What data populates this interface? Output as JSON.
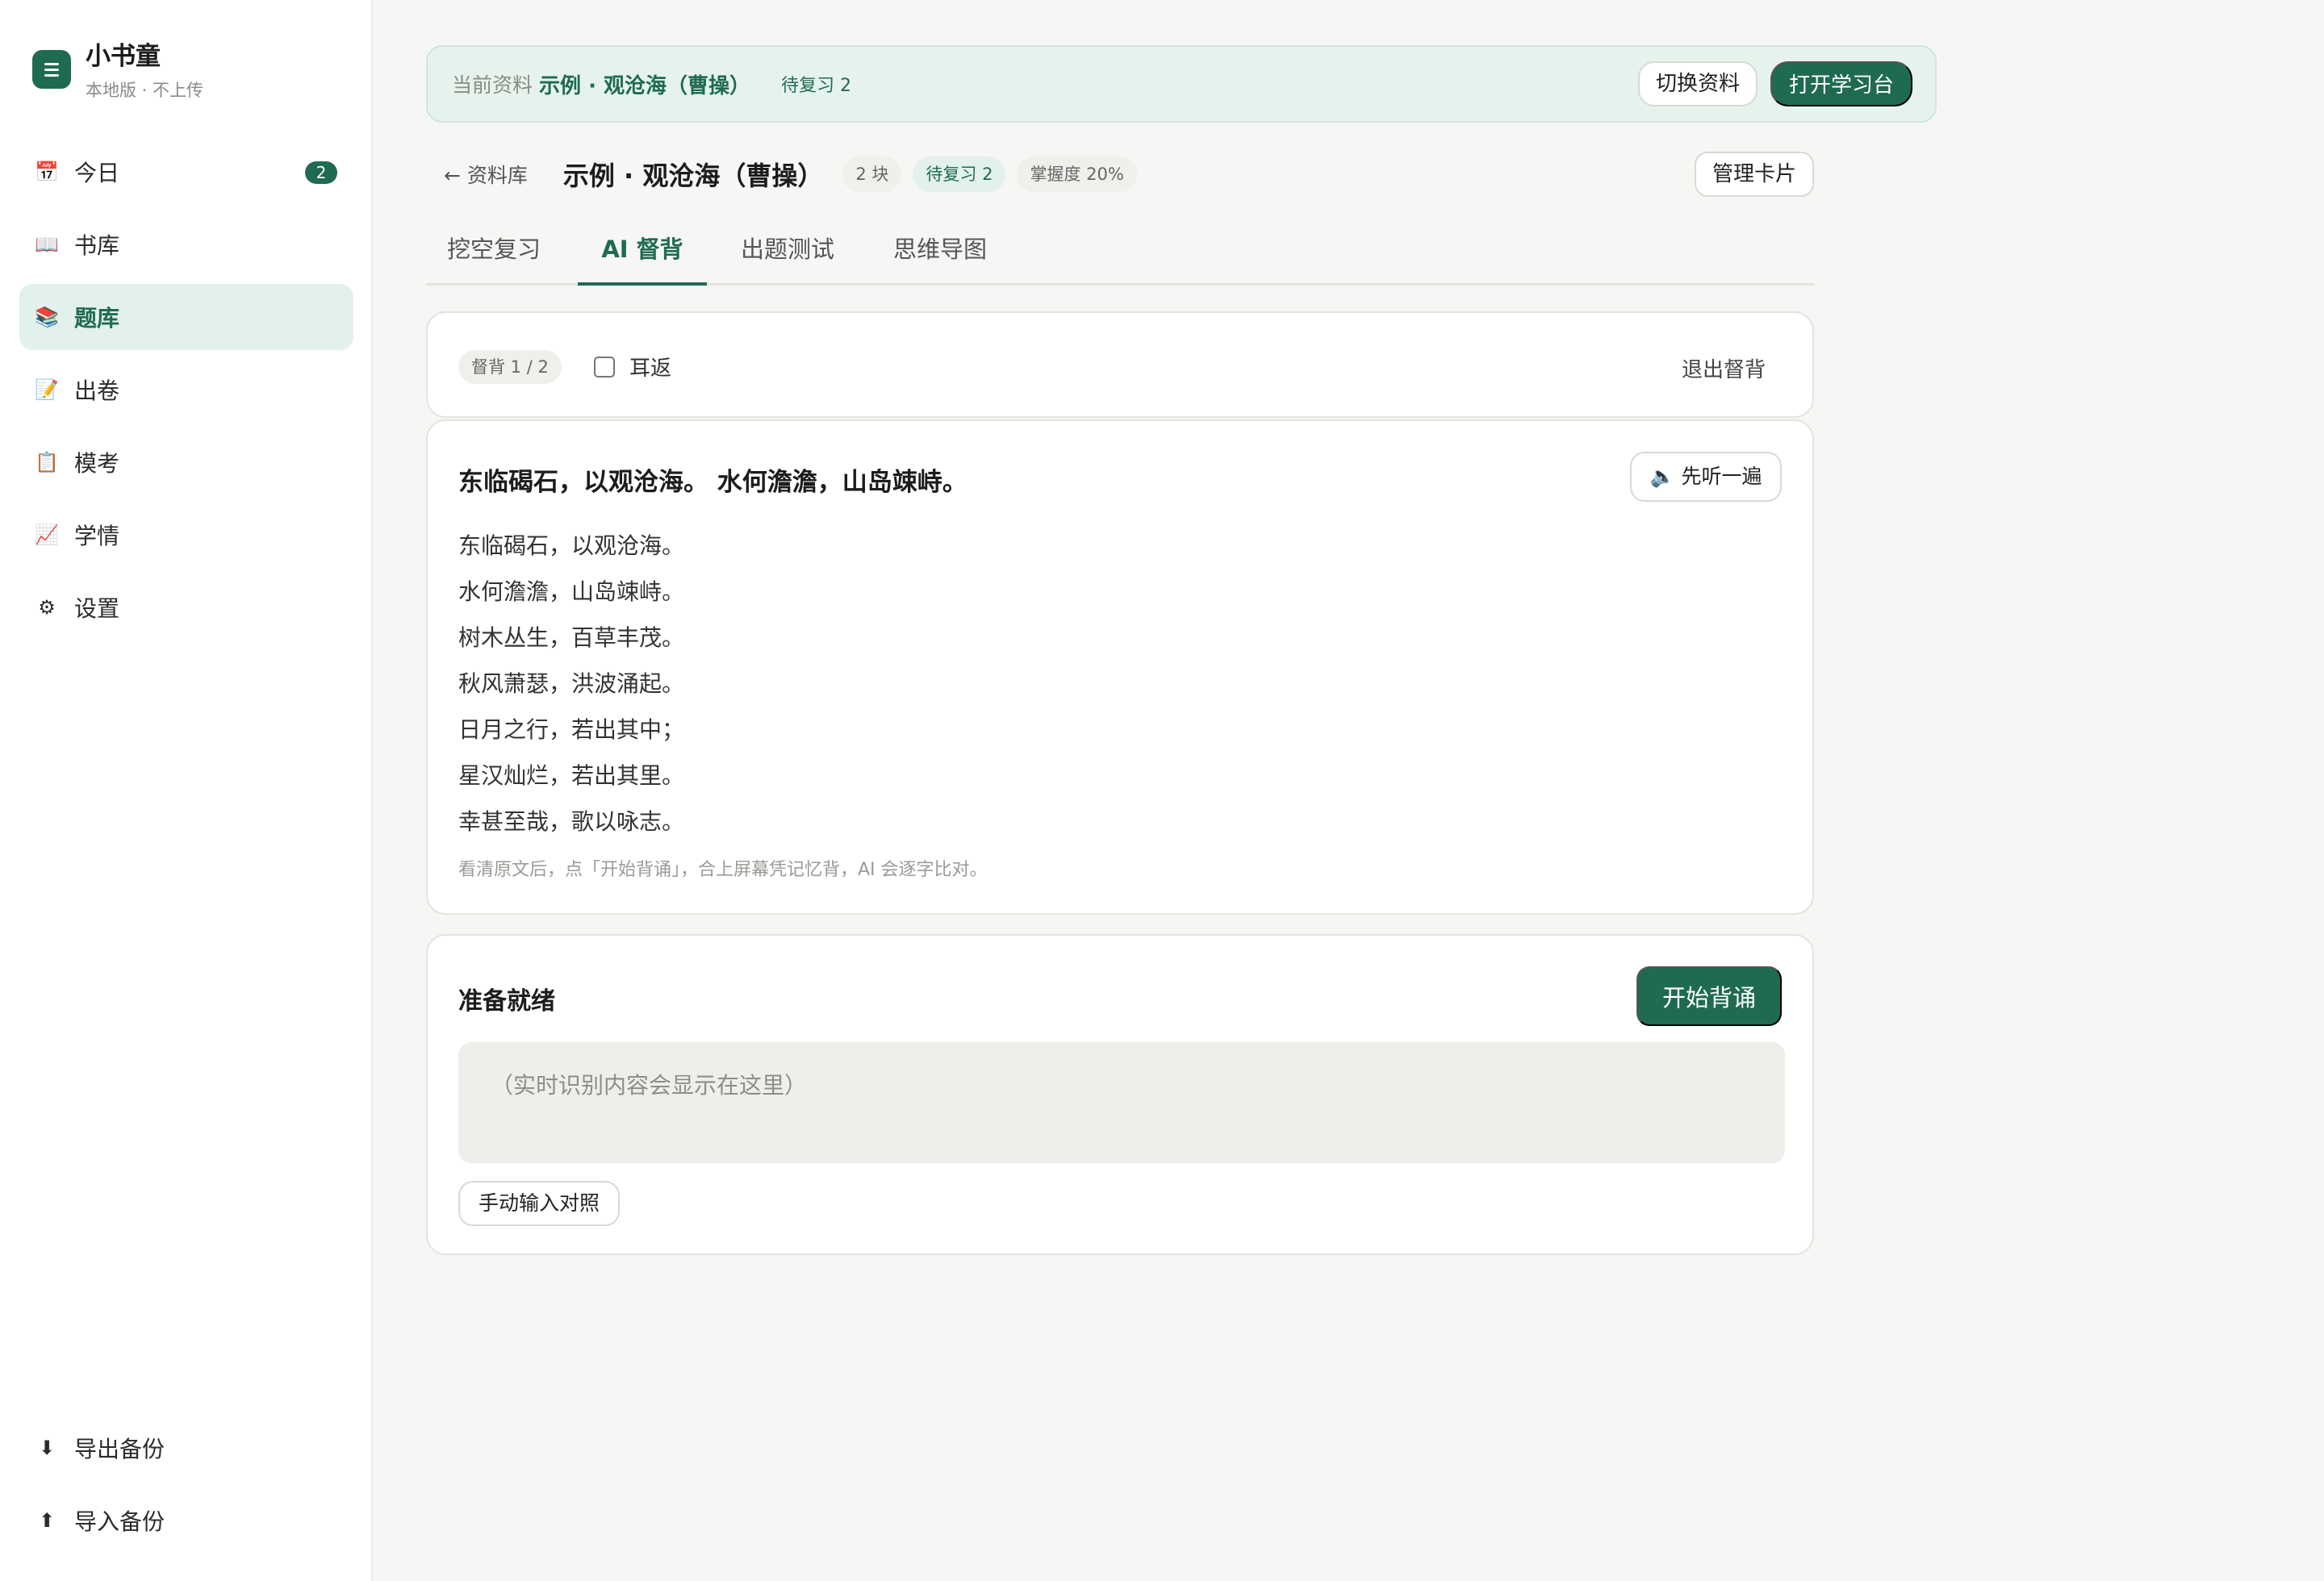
{
  "app": {
    "title": "小书童",
    "subtitle": "本地版 · 不上传"
  },
  "sidebar": {
    "items": [
      {
        "label": "今日",
        "icon": "calendar-icon",
        "glyph": "📅",
        "badge": "2"
      },
      {
        "label": "书库",
        "icon": "book-icon",
        "glyph": "📖"
      },
      {
        "label": "题库",
        "icon": "books-icon",
        "glyph": "📚",
        "active": true
      },
      {
        "label": "出卷",
        "icon": "memo-icon",
        "glyph": "📝"
      },
      {
        "label": "模考",
        "icon": "clipboard-icon",
        "glyph": "📋"
      },
      {
        "label": "学情",
        "icon": "chart-icon",
        "glyph": "📈"
      },
      {
        "label": "设置",
        "icon": "gear-icon",
        "glyph": "⚙"
      }
    ],
    "bottom": [
      {
        "label": "导出备份",
        "icon": "download-icon",
        "glyph": "⬇"
      },
      {
        "label": "导入备份",
        "icon": "upload-icon",
        "glyph": "⬆"
      }
    ]
  },
  "banner": {
    "label": "当前资料",
    "title": "示例 · 观沧海（曹操）",
    "due": "待复习 2",
    "switch_label": "切换资料",
    "open_label": "打开学习台"
  },
  "header": {
    "back_label": "← 资料库",
    "title": "示例 · 观沧海（曹操）",
    "chips": {
      "blocks": "2 块",
      "due": "待复习 2",
      "mastery": "掌握度 20%"
    },
    "manage_label": "管理卡片"
  },
  "tabs": [
    "挖空复习",
    "AI 督背",
    "出题测试",
    "思维导图"
  ],
  "active_tab": 1,
  "session": {
    "step": "督背 1 / 2",
    "echo_label": "耳返",
    "echo_checked": false,
    "exit_label": "退出督背"
  },
  "passage": {
    "heading": "东临碣石，以观沧海。 水何澹澹，山岛竦峙。",
    "listen_label": "先听一遍",
    "lines": [
      "东临碣石，以观沧海。",
      "水何澹澹，山岛竦峙。",
      "树木丛生，百草丰茂。",
      "秋风萧瑟，洪波涌起。",
      "日月之行，若出其中；",
      "星汉灿烂，若出其里。",
      "幸甚至哉，歌以咏志。"
    ],
    "hint": "看清原文后，点「开始背诵」，合上屏幕凭记忆背，AI 会逐字比对。"
  },
  "recite": {
    "title": "准备就绪",
    "start_label": "开始背诵",
    "transcript_placeholder": "（实时识别内容会显示在这里）",
    "manual_label": "手动输入对照"
  },
  "colors": {
    "accent": "#1f6b52",
    "accent_light": "#e3f1ec"
  }
}
